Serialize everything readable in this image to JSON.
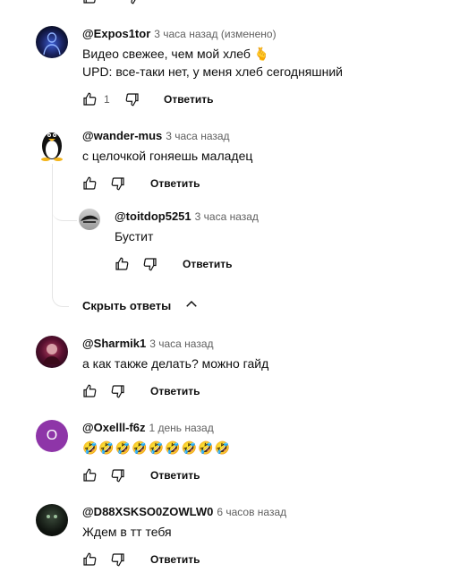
{
  "comments": [
    {
      "author": "@Expos1tor",
      "time": "3 часа назад (изменено)",
      "lines": [
        "Видео свежее, чем мой хлеб 🫰",
        "UPD: все-таки нет, у меня хлеб сегодняшний"
      ],
      "likes": "1",
      "reply": "Ответить"
    },
    {
      "author": "@wander-mus",
      "time": "3 часа назад",
      "lines": [
        "с целочкой гоняешь маладец"
      ],
      "reply": "Ответить"
    },
    {
      "author": "@toitdop5251",
      "time": "3 часа назад",
      "lines": [
        "Бустит"
      ],
      "reply": "Ответить"
    },
    {
      "author": "@Sharmik1",
      "time": "3 часа назад",
      "lines": [
        "а как также делать? можно гайд"
      ],
      "reply": "Ответить"
    },
    {
      "author": "@Oxelll-f6z",
      "time": "1 день назад",
      "avatar_letter": "O",
      "lines": [
        "🤣🤣🤣🤣🤣🤣🤣🤣🤣"
      ],
      "reply": "Ответить"
    },
    {
      "author": "@D88XSKSO0ZOWLW0",
      "time": "6 часов назад",
      "lines": [
        "Ждем в тт тебя"
      ],
      "reply": "Ответить"
    }
  ],
  "hide_replies_label": "Скрыть ответы",
  "colors": {
    "oxelll_avatar": "#8e35a8",
    "emoji": "#f8c21a"
  }
}
